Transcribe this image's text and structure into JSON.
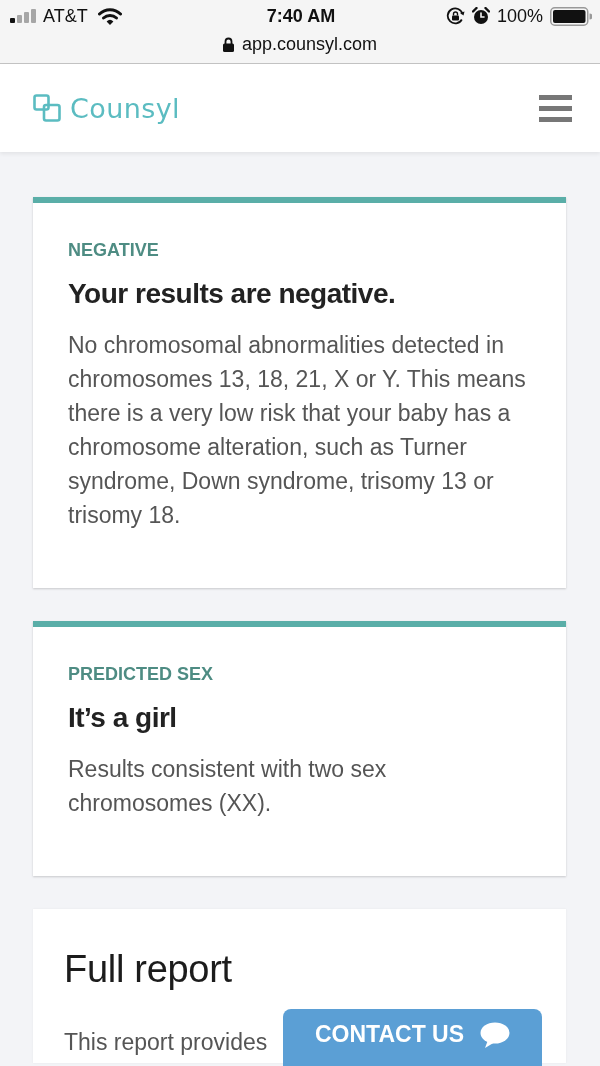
{
  "status_bar": {
    "carrier": "AT&T",
    "time": "7:40 AM",
    "battery": "100%"
  },
  "address_bar": {
    "url": "app.counsyl.com"
  },
  "header": {
    "logo": "Counsyl"
  },
  "cards": [
    {
      "kind": "result",
      "label": "NEGATIVE",
      "title": "Your results are negative.",
      "body": "No chromosomal abnormalities detected in chromosomes 13, 18, 21, X or Y. This means there is a very low risk that your baby has a chromosome alteration, such as Turner syndrome, Down syndrome, trisomy 13 or trisomy 18."
    },
    {
      "kind": "result",
      "label": "PREDICTED SEX",
      "title": "It’s a girl",
      "body": "Results consistent with two sex chromosomes (XX)."
    },
    {
      "kind": "report",
      "title": "Full report",
      "body": "This report provides"
    }
  ],
  "contact_button": {
    "label": "CONTACT US"
  }
}
